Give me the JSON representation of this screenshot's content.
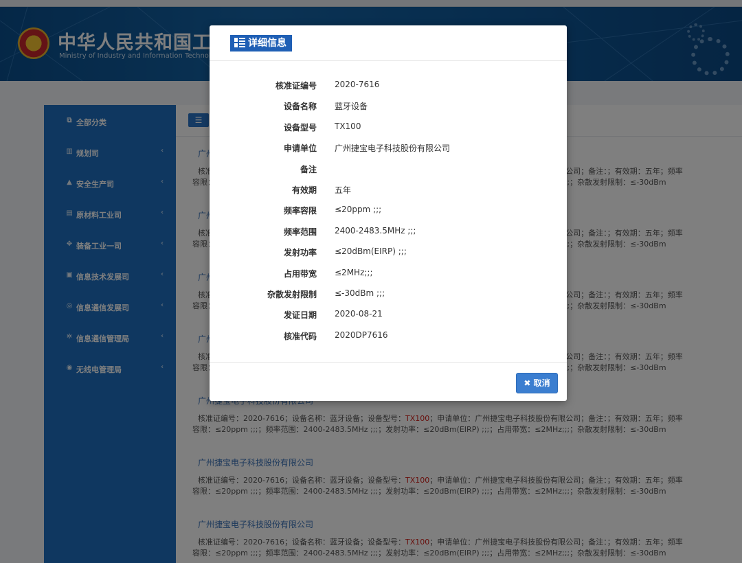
{
  "banner": {
    "title": "中华人民共和国工业和信息化部",
    "subtitle": "Ministry of Industry and Information Technology of the People's Republic of China"
  },
  "sidebar": {
    "items": [
      {
        "label": "全部分类",
        "icon": "copy-icon",
        "glyph": "⧉"
      },
      {
        "label": "规划司",
        "icon": "bar-chart-icon",
        "glyph": "▥"
      },
      {
        "label": "安全生产司",
        "icon": "warning-icon",
        "glyph": "▲"
      },
      {
        "label": "原材料工业司",
        "icon": "database-icon",
        "glyph": "▤"
      },
      {
        "label": "装备工业一司",
        "icon": "cubes-icon",
        "glyph": "✥"
      },
      {
        "label": "信息技术发展司",
        "icon": "briefcase-icon",
        "glyph": "▣"
      },
      {
        "label": "信息通信发展司",
        "icon": "globe-icon",
        "glyph": "◎"
      },
      {
        "label": "信息通信管理局",
        "icon": "gears-icon",
        "glyph": "✲"
      },
      {
        "label": "无线电管理局",
        "icon": "wifi-icon",
        "glyph": "◉"
      }
    ]
  },
  "entry_template": {
    "company": "广州捷宝电子科技股份有限公司",
    "line1_pre": "核准证编号：2020-7616；设备名称：蓝牙设备；设备型号：",
    "line1_model": "TX100",
    "line1_post": "；申请单位：广州捷宝电子科技股份有限公司；备注：；有效期：五年；频率",
    "line2": "容限：≤20ppm ;;;；频率范围：2400-2483.5MHz ;;;；发射功率：≤20dBm(EIRP) ;;;；占用带宽：≤2MHz;;;；杂散发射限制：≤-30dBm"
  },
  "modal": {
    "title": "详细信息",
    "fields": [
      {
        "label": "核准证编号",
        "value": "2020-7616"
      },
      {
        "label": "设备名称",
        "value": "蓝牙设备"
      },
      {
        "label": "设备型号",
        "value": "TX100"
      },
      {
        "label": "申请单位",
        "value": "广州捷宝电子科技股份有限公司"
      },
      {
        "label": "备注",
        "value": ""
      },
      {
        "label": "有效期",
        "value": "五年"
      },
      {
        "label": "频率容限",
        "value": "≤20ppm ;;;"
      },
      {
        "label": "频率范围",
        "value": "2400-2483.5MHz ;;;"
      },
      {
        "label": "发射功率",
        "value": "≤20dBm(EIRP) ;;;"
      },
      {
        "label": "占用带宽",
        "value": "≤2MHz;;;"
      },
      {
        "label": "杂散发射限制",
        "value": "≤-30dBm ;;;"
      },
      {
        "label": "发证日期",
        "value": "2020-08-21"
      },
      {
        "label": "核准代码",
        "value": "2020DP7616"
      }
    ],
    "cancel_label": "取消"
  },
  "colors": {
    "banner": "#1565a8",
    "sidebar": "#1e6fc0",
    "title_badge": "#1f5fb5",
    "cancel_button": "#3b7ed0",
    "model_highlight": "#d0201a",
    "link": "#3b73b9"
  }
}
